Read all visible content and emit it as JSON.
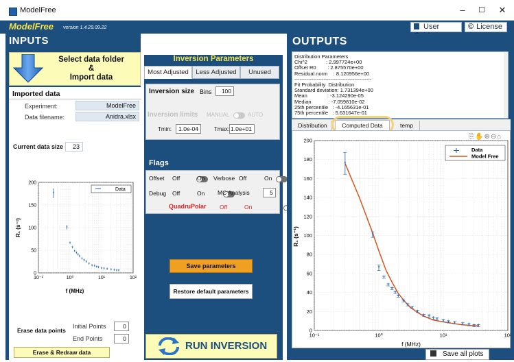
{
  "window": {
    "title": "ModelFree",
    "controls": [
      "–",
      "☐",
      "✕"
    ]
  },
  "header": {
    "app_name": "ModelFree",
    "version": "version 1.4.29.09.22",
    "user_guide": "User Guide",
    "license": "License",
    "license_icon": "©"
  },
  "inputs": {
    "title": "INPUTS",
    "select_button": "Select data folder\n&\nImport data",
    "imported_heading": "Imported data",
    "experiment_label": "Experiment:",
    "experiment_value": "ModelFree",
    "filename_label": "Data filename:",
    "filename_value": "Anidra.xlsx",
    "data_size_label": "Current data size",
    "data_size_value": "23",
    "erase_label": "Erase data points",
    "initial_points_label": "Initial Points",
    "initial_points_value": "0",
    "end_points_label": "End Points",
    "end_points_value": "0",
    "erase_button": "Erase & Redraw data"
  },
  "inversion": {
    "title": "Inversion Parameters",
    "tabs": [
      "Most Adjusted",
      "Less Adjusted",
      "Unused"
    ],
    "size_label": "Inversion size",
    "bins_label": "Bins",
    "bins_value": "100",
    "limits_label": "Inversion limits",
    "manual": "MANUAL",
    "auto": "AUTO",
    "tmin_label": "Tmin:",
    "tmin_value": "1.0e-04",
    "tmax_label": "Tmax:",
    "tmax_value": "1.0e+01",
    "flags_title": "Flags",
    "offset": "Offset",
    "verbose": "Verbose",
    "debug": "Debug",
    "mc_label": "MC Analysis",
    "mc_value": "5",
    "quadrupolar": "QuadruPolar",
    "off": "Off",
    "on": "On",
    "save_params": "Save parameters",
    "restore": "Restore default parameters",
    "run": "RUN INVERSION"
  },
  "outputs": {
    "title": "OUTPUTS",
    "text": "Distribution Parameters\nChi^2             : 2.997724e+00\nOffset R0        : 2.875570e+00\nResidual norm    : 8.120956e+00\n---------------------------------------------\nFit Probability  Distribution\nStandard deviation: 1.731394e+00\nMean              : -3.124290e-05\nMedian            : -7.059810e-02\n25th percentile   : -4.165631e-01\n75th percentile   : 5.631647e-01",
    "tabs": [
      "Distribution",
      "Computed Data",
      "temp"
    ],
    "save_all": "Save all plots",
    "legend_data": "Data",
    "legend_fit": "Model Free"
  },
  "chart_data": [
    {
      "type": "scatter",
      "title": "",
      "xlabel": "f (MHz)",
      "ylabel": "R₁ (s⁻¹)",
      "xscale": "log",
      "xlim": [
        0.1,
        100
      ],
      "ylim": [
        0,
        200
      ],
      "yticks": [
        0,
        50,
        100,
        150,
        200
      ],
      "legend": "top-right",
      "series": [
        {
          "name": "Data",
          "x": [
            0.3,
            0.8,
            1.0,
            1.2,
            1.4,
            1.6,
            1.8,
            2.0,
            2.4,
            2.8,
            3.3,
            4.0,
            5.0,
            6.0,
            7.0,
            8.0,
            10,
            12,
            15,
            20,
            25,
            30,
            35
          ],
          "y": [
            176,
            101,
            66,
            56,
            48,
            44,
            40,
            36,
            31,
            27,
            24,
            20,
            16,
            15,
            13,
            12,
            10,
            9,
            8,
            7,
            6,
            5,
            5
          ]
        }
      ]
    },
    {
      "type": "line",
      "title": "",
      "xlabel": "f (MHz)",
      "ylabel": "R₁ (s⁻¹)",
      "xscale": "log",
      "xlim": [
        0.1,
        100
      ],
      "ylim": [
        0,
        200
      ],
      "yticks": [
        0,
        20,
        40,
        60,
        80,
        100,
        120,
        140,
        160,
        180,
        200
      ],
      "legend": "top-right",
      "series": [
        {
          "name": "Data",
          "x": [
            0.3,
            0.8,
            1.0,
            1.2,
            1.4,
            1.6,
            1.8,
            2.0,
            2.4,
            2.8,
            3.3,
            4.0,
            5.0,
            6.0,
            7.0,
            8.0,
            10,
            12,
            15,
            20,
            25,
            30,
            35
          ],
          "y": [
            176,
            101,
            66,
            56,
            48,
            44,
            40,
            36,
            31,
            27,
            24,
            20,
            16,
            15,
            13,
            12,
            10,
            9,
            8,
            7,
            6,
            5,
            5
          ]
        },
        {
          "name": "Model Free",
          "x": [
            0.3,
            0.5,
            0.8,
            1.0,
            1.3,
            1.6,
            2.0,
            2.5,
            3.0,
            4.0,
            5.0,
            7.0,
            10,
            15,
            20,
            30,
            35
          ],
          "y": [
            176,
            140,
            103,
            84,
            63,
            51,
            39,
            31,
            25,
            19,
            15,
            11,
            9,
            7,
            6,
            5,
            5
          ]
        }
      ]
    }
  ]
}
